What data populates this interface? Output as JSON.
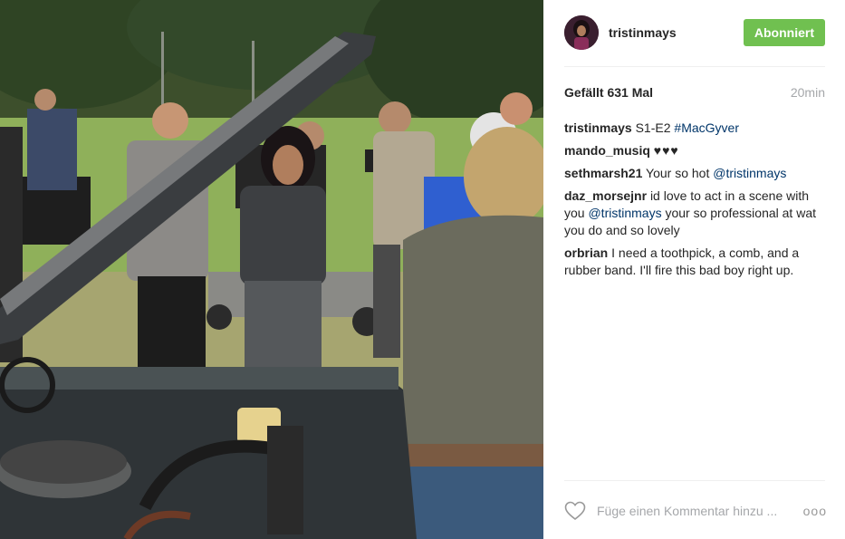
{
  "post": {
    "username": "tristinmays",
    "follow_label": "Abonniert",
    "likes_text": "Gefällt 631 Mal",
    "time_text": "20min",
    "comments": [
      {
        "user": "tristinmays",
        "segments": [
          {
            "type": "text",
            "text": "S1-E2 "
          },
          {
            "type": "link",
            "text": "#MacGyver"
          }
        ]
      },
      {
        "user": "mando_musiq",
        "segments": [
          {
            "type": "text",
            "text": "♥♥♥"
          }
        ]
      },
      {
        "user": "sethmarsh21",
        "segments": [
          {
            "type": "text",
            "text": "Your so hot "
          },
          {
            "type": "link",
            "text": "@tristinmays"
          }
        ]
      },
      {
        "user": "daz_morsejnr",
        "segments": [
          {
            "type": "text",
            "text": "id love to act in a scene with you "
          },
          {
            "type": "link",
            "text": "@tristinmays"
          },
          {
            "type": "text",
            "text": " your so professional at wat you do and so lovely"
          }
        ]
      },
      {
        "user": "orbrian",
        "segments": [
          {
            "type": "text",
            "text": "I need a toothpick, a comb, and a rubber band. I'll fire this bad boy right up."
          }
        ]
      }
    ],
    "comment_placeholder": "Füge einen Kommentar hinzu ...",
    "more_label": "ooo"
  },
  "icons": {
    "like": "heart-outline-icon",
    "more": "more-options-icon"
  },
  "colors": {
    "follow_button": "#70c050",
    "link": "#003569",
    "muted": "#a5a7aa"
  }
}
